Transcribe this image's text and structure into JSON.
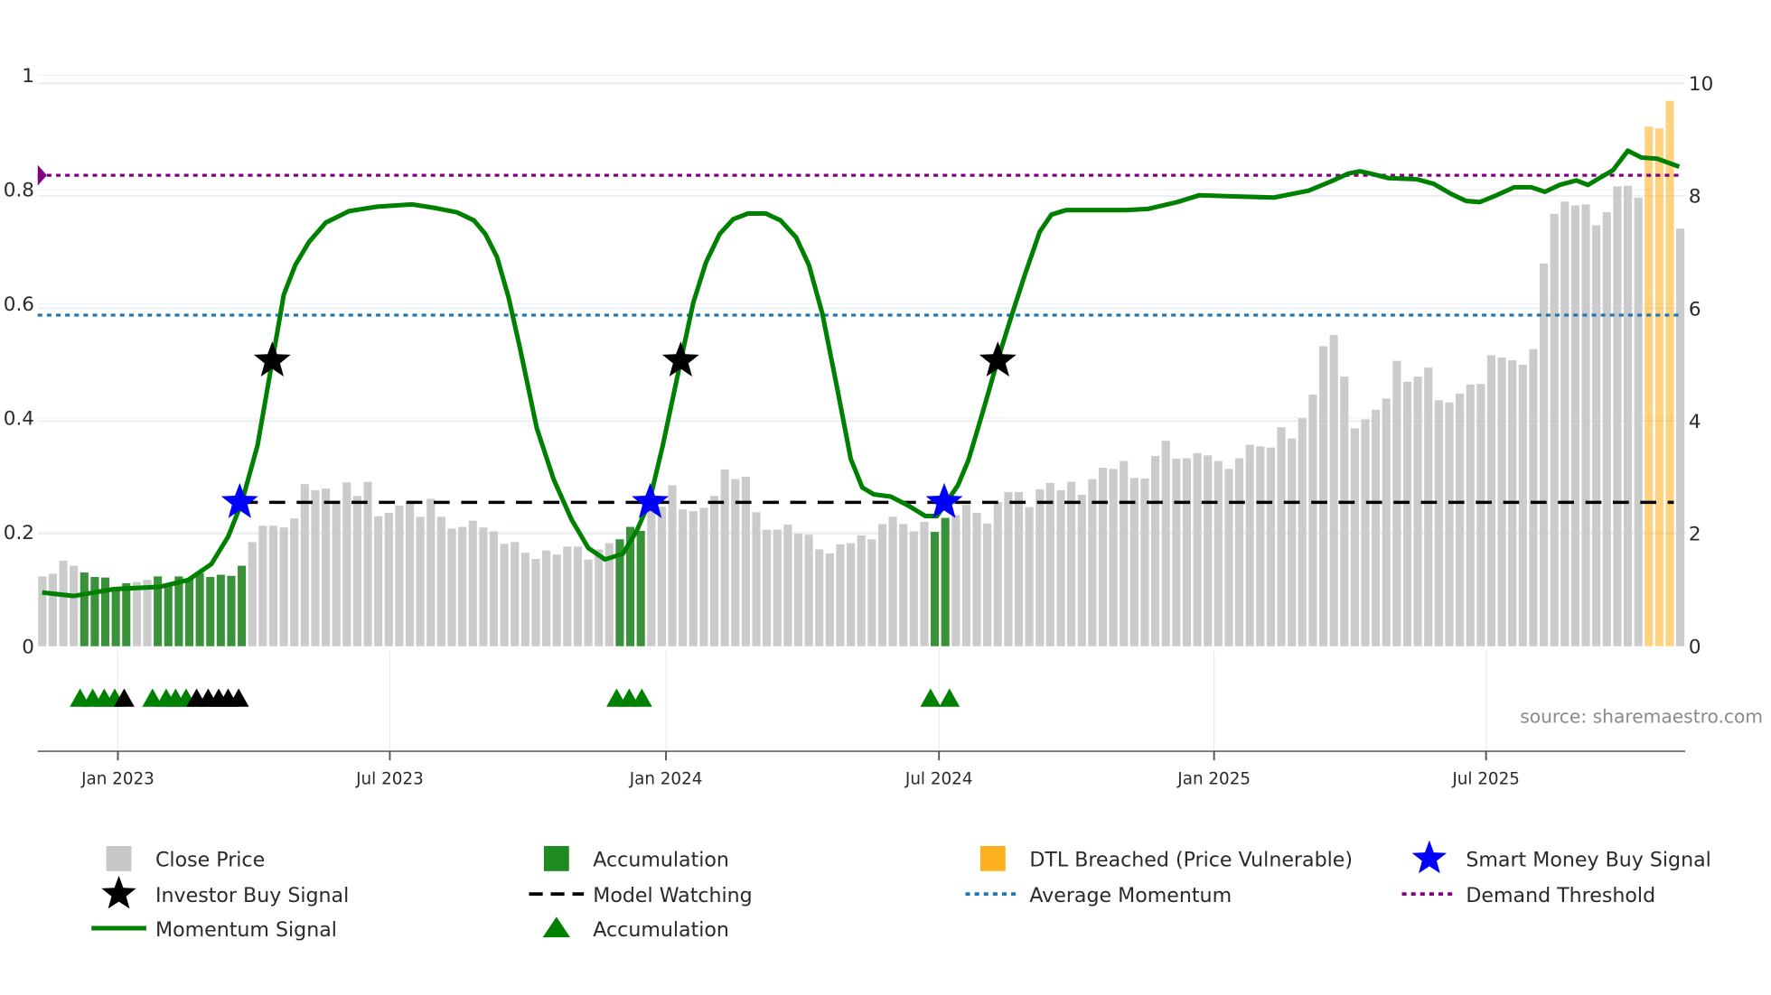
{
  "chart_data": {
    "type": "bar",
    "x_unit": "week index",
    "left_axis": {
      "ylim": [
        0,
        1
      ],
      "ticks": [
        "0",
        "0.2",
        "0.4",
        "0.6",
        "0.8",
        "1"
      ],
      "tick_values": [
        0,
        0.2,
        0.4,
        0.6,
        0.8,
        1
      ]
    },
    "right_axis": {
      "ylim": [
        0,
        10
      ],
      "ticks": [
        "0",
        "2",
        "4",
        "6",
        "8",
        "10"
      ],
      "tick_values": [
        0,
        2,
        4,
        6,
        8,
        10
      ]
    },
    "x_ticks": [
      {
        "label": "Jan 2023",
        "week": 7.2
      },
      {
        "label": "Jul 2023",
        "week": 33.1
      },
      {
        "label": "Jan 2024",
        "week": 59.4
      },
      {
        "label": "Jul 2024",
        "week": 85.4
      },
      {
        "label": "Jan 2025",
        "week": 111.6
      },
      {
        "label": "Jul 2025",
        "week": 137.5
      }
    ],
    "close_price": [
      1.24,
      1.29,
      1.52,
      1.43,
      1.31,
      1.23,
      1.22,
      1.01,
      1.12,
      1.14,
      1.18,
      1.24,
      1.11,
      1.24,
      1.2,
      1.3,
      1.23,
      1.27,
      1.25,
      1.43,
      1.85,
      2.14,
      2.14,
      2.11,
      2.27,
      2.88,
      2.77,
      2.8,
      2.58,
      2.91,
      2.67,
      2.92,
      2.31,
      2.37,
      2.5,
      2.54,
      2.3,
      2.62,
      2.3,
      2.09,
      2.12,
      2.23,
      2.11,
      2.04,
      1.82,
      1.85,
      1.66,
      1.55,
      1.7,
      1.63,
      1.77,
      1.77,
      1.54,
      1.72,
      1.83,
      1.9,
      2.12,
      2.05,
      2.45,
      2.48,
      2.86,
      2.43,
      2.4,
      2.46,
      2.67,
      3.14,
      2.97,
      3.01,
      2.38,
      2.07,
      2.07,
      2.16,
      2.0,
      1.98,
      1.72,
      1.65,
      1.81,
      1.83,
      1.97,
      1.9,
      2.17,
      2.3,
      2.17,
      2.04,
      2.21,
      2.03,
      2.28,
      2.33,
      2.51,
      2.37,
      2.18,
      2.56,
      2.74,
      2.74,
      2.47,
      2.79,
      2.9,
      2.77,
      2.92,
      2.69,
      2.97,
      3.17,
      3.15,
      3.29,
      2.99,
      2.98,
      3.38,
      3.65,
      3.33,
      3.34,
      3.43,
      3.39,
      3.29,
      3.15,
      3.34,
      3.58,
      3.55,
      3.53,
      3.89,
      3.69,
      4.05,
      4.47,
      5.33,
      5.53,
      4.79,
      3.87,
      4.03,
      4.2,
      4.4,
      5.07,
      4.7,
      4.79,
      4.95,
      4.37,
      4.33,
      4.49,
      4.65,
      4.66,
      5.17,
      5.13,
      5.08,
      5.0,
      5.28,
      6.8,
      7.68,
      7.9,
      7.83,
      7.85,
      7.48,
      7.71,
      8.17,
      8.18,
      7.97,
      9.23,
      9.2,
      9.69,
      7.42
    ],
    "accumulation_weeks": [
      4,
      5,
      6,
      7,
      8,
      11,
      12,
      13,
      14,
      15,
      16,
      17,
      18,
      19,
      55,
      56,
      57,
      85,
      86
    ],
    "dtl_breached_weeks": [
      153,
      154,
      155
    ],
    "momentum_signal": [
      [
        0,
        0.094
      ],
      [
        3,
        0.088
      ],
      [
        6.8,
        0.1
      ],
      [
        11.2,
        0.104
      ],
      [
        13.9,
        0.116
      ],
      [
        16.1,
        0.144
      ],
      [
        17.7,
        0.192
      ],
      [
        19,
        0.252
      ],
      [
        20.5,
        0.352
      ],
      [
        21.9,
        0.5
      ],
      [
        23,
        0.616
      ],
      [
        24.1,
        0.668
      ],
      [
        25.4,
        0.708
      ],
      [
        27,
        0.742
      ],
      [
        29.2,
        0.762
      ],
      [
        31.9,
        0.77
      ],
      [
        35.2,
        0.774
      ],
      [
        37.3,
        0.768
      ],
      [
        39.5,
        0.76
      ],
      [
        41.1,
        0.746
      ],
      [
        42.2,
        0.722
      ],
      [
        43.3,
        0.682
      ],
      [
        44.4,
        0.612
      ],
      [
        45.5,
        0.522
      ],
      [
        47.1,
        0.382
      ],
      [
        48.7,
        0.292
      ],
      [
        50.4,
        0.222
      ],
      [
        52,
        0.172
      ],
      [
        53.6,
        0.152
      ],
      [
        55.3,
        0.162
      ],
      [
        56.6,
        0.202
      ],
      [
        57.8,
        0.252
      ],
      [
        59.1,
        0.352
      ],
      [
        60.8,
        0.5
      ],
      [
        62,
        0.602
      ],
      [
        63.2,
        0.672
      ],
      [
        64.5,
        0.722
      ],
      [
        65.8,
        0.748
      ],
      [
        67.2,
        0.758
      ],
      [
        68.9,
        0.758
      ],
      [
        70.3,
        0.746
      ],
      [
        71.8,
        0.716
      ],
      [
        73,
        0.668
      ],
      [
        74.3,
        0.582
      ],
      [
        75.7,
        0.452
      ],
      [
        77,
        0.328
      ],
      [
        78.1,
        0.278
      ],
      [
        79.2,
        0.266
      ],
      [
        80.8,
        0.262
      ],
      [
        82.5,
        0.246
      ],
      [
        84.1,
        0.228
      ],
      [
        85.2,
        0.228
      ],
      [
        86.1,
        0.252
      ],
      [
        87.2,
        0.282
      ],
      [
        88.2,
        0.326
      ],
      [
        89.6,
        0.412
      ],
      [
        91,
        0.502
      ],
      [
        92.3,
        0.578
      ],
      [
        93.6,
        0.652
      ],
      [
        95,
        0.726
      ],
      [
        96.1,
        0.756
      ],
      [
        97.5,
        0.764
      ],
      [
        100.4,
        0.764
      ],
      [
        103.2,
        0.764
      ],
      [
        105.3,
        0.766
      ],
      [
        108.1,
        0.778
      ],
      [
        110.2,
        0.79
      ],
      [
        113.5,
        0.788
      ],
      [
        117.3,
        0.786
      ],
      [
        120.6,
        0.798
      ],
      [
        122.7,
        0.814
      ],
      [
        124.4,
        0.828
      ],
      [
        125.5,
        0.832
      ],
      [
        126.5,
        0.828
      ],
      [
        128.2,
        0.82
      ],
      [
        130.9,
        0.818
      ],
      [
        132.5,
        0.81
      ],
      [
        134.2,
        0.792
      ],
      [
        135.6,
        0.78
      ],
      [
        136.9,
        0.778
      ],
      [
        138.5,
        0.79
      ],
      [
        140.2,
        0.804
      ],
      [
        141.8,
        0.804
      ],
      [
        143.1,
        0.796
      ],
      [
        144.5,
        0.808
      ],
      [
        146.1,
        0.816
      ],
      [
        147.2,
        0.808
      ],
      [
        148.3,
        0.82
      ],
      [
        149.6,
        0.834
      ],
      [
        151,
        0.868
      ],
      [
        152.3,
        0.856
      ],
      [
        153.8,
        0.854
      ],
      [
        155.9,
        0.84
      ]
    ],
    "reference_lines": {
      "demand_threshold": 0.825,
      "average_momentum": 0.58,
      "model_watching": 0.252,
      "model_watching_from_week": 19
    },
    "smart_money_buy_signals": [
      {
        "week": 18.8,
        "value": 0.252
      },
      {
        "week": 57.9,
        "value": 0.252
      },
      {
        "week": 85.9,
        "value": 0.252
      }
    ],
    "investor_buy_signals": [
      {
        "week": 21.9,
        "value": 0.5
      },
      {
        "week": 60.8,
        "value": 0.5
      },
      {
        "week": 91,
        "value": 0.5
      }
    ],
    "accumulation_markers_green": [
      3.6,
      4.8,
      5.9,
      6.9,
      10.5,
      11.8,
      12.7,
      13.7,
      54.7,
      55.9,
      57.1,
      84.6,
      86.4
    ],
    "accumulation_markers_black": [
      7.8,
      14.7,
      15.8,
      16.8,
      17.7,
      18.7
    ],
    "legend_placement": "bottom",
    "grid": true
  },
  "colors": {
    "close_price": "#c8c8c8",
    "accumulation": "#2e8b2e",
    "dtl": "#ffa500",
    "momentum": "#008000",
    "smart_money": "#0000ff",
    "investor": "#000000",
    "avg_momentum": "#1f77b4",
    "demand": "#800080"
  },
  "legend": [
    {
      "key": "close",
      "label": "Close Price"
    },
    {
      "key": "accum_bar",
      "label": "Accumulation"
    },
    {
      "key": "dtl",
      "label": "DTL Breached (Price Vulnerable)"
    },
    {
      "key": "smart",
      "label": "Smart Money Buy Signal"
    },
    {
      "key": "investor",
      "label": "Investor Buy Signal"
    },
    {
      "key": "watch",
      "label": "Model Watching"
    },
    {
      "key": "avg",
      "label": "Average Momentum"
    },
    {
      "key": "demand",
      "label": "Demand Threshold"
    },
    {
      "key": "momentum",
      "label": "Momentum Signal"
    },
    {
      "key": "accum_tri",
      "label": "Accumulation"
    }
  ],
  "source": "source: sharemaestro.com"
}
